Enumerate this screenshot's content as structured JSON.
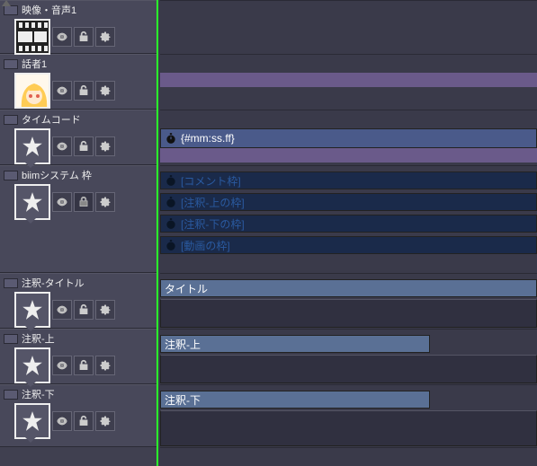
{
  "tracks": [
    {
      "name": "映像・音声1",
      "thumb": "film",
      "locked": false
    },
    {
      "name": "話者1",
      "thumb": "avatar",
      "locked": false
    },
    {
      "name": "タイムコード",
      "thumb": "star",
      "locked": false
    },
    {
      "name": "biimシステム 枠",
      "thumb": "star",
      "locked": true
    },
    {
      "name": "注釈-タイトル",
      "thumb": "star",
      "locked": false
    },
    {
      "name": "注釈-上",
      "thumb": "star",
      "locked": false
    },
    {
      "name": "注釈-下",
      "thumb": "star",
      "locked": false
    }
  ],
  "clips": {
    "timecode_text": "{#mm:ss.ff}",
    "frame_labels": [
      "[コメント枠]",
      "[注釈-上の枠]",
      "[注釈-下の枠]",
      "[動画の枠]"
    ],
    "title_clip": "タイトル",
    "anno_top": "注釈-上",
    "anno_bottom": "注釈-下"
  }
}
